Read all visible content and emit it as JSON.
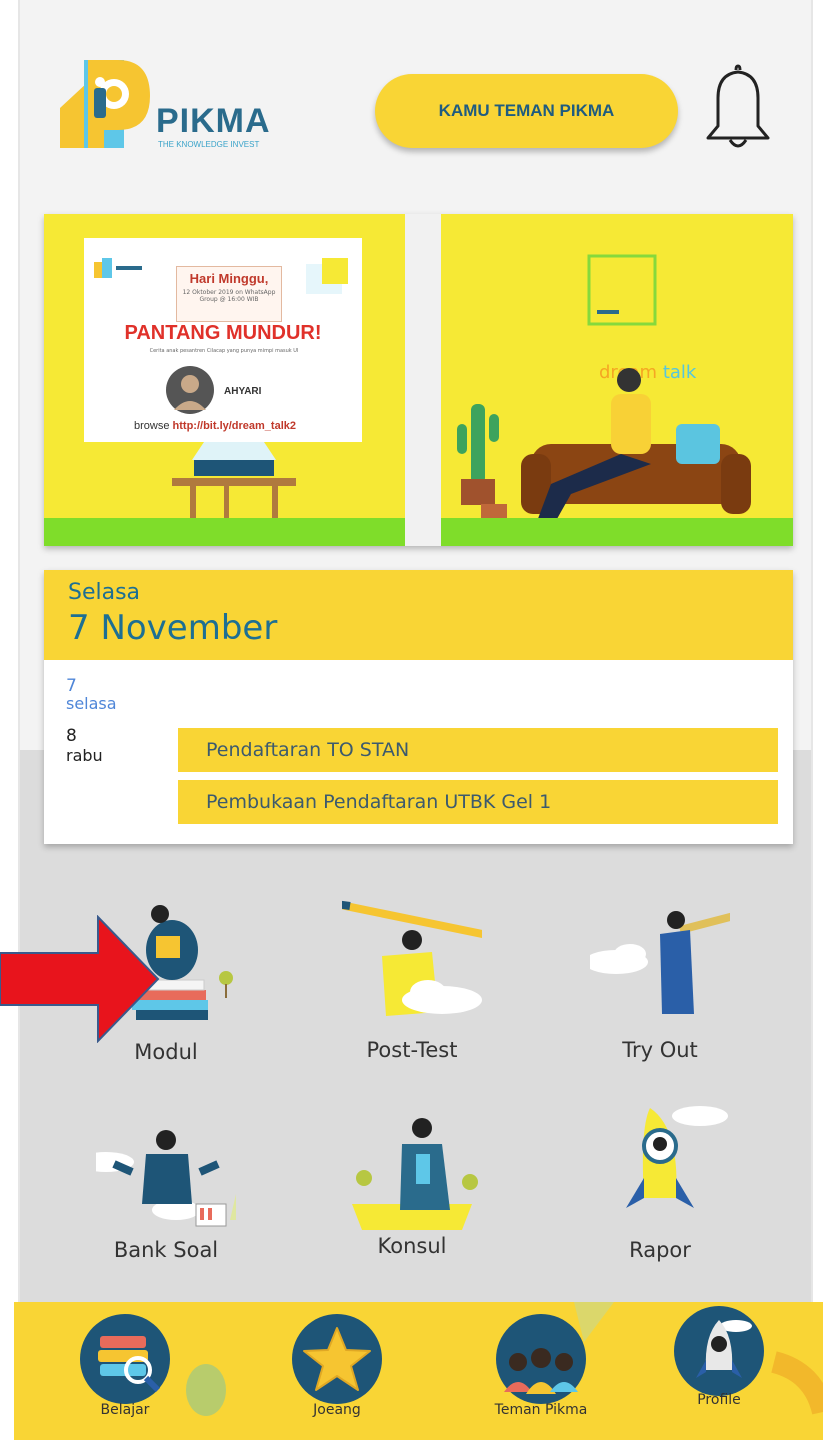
{
  "header": {
    "logo_text": "PIKMA",
    "logo_subtitle": "THE KNOWLEDGE INVEST",
    "teman_button": "KAMU TEMAN PIKMA"
  },
  "banner": {
    "poster_date": "Hari Minggu,",
    "poster_date_sub": "12 Oktober 2019 on WhatsApp Group @ 16:00 WIB",
    "poster_title": "PANTANG MUNDUR!",
    "poster_tagline": "Cerita anak pesantren Cilacap yang punya mimpi masuk UI",
    "speaker_name": "AHYARI",
    "link_prefix": "browse",
    "link_url": "http://bit.ly/dream_talk2",
    "brand_right_1": "dream",
    "brand_right_2": "talk"
  },
  "calendar": {
    "header_day": "Selasa",
    "header_date": "7 November",
    "days": [
      {
        "num": "7",
        "label": "selasa"
      },
      {
        "num": "8",
        "label": "rabu"
      }
    ],
    "events": [
      "Pendaftaran TO STAN",
      "Pembukaan Pendaftaran UTBK Gel 1"
    ]
  },
  "menu": [
    {
      "label": "Modul"
    },
    {
      "label": "Post-Test"
    },
    {
      "label": "Try Out"
    },
    {
      "label": "Bank Soal"
    },
    {
      "label": "Konsul"
    },
    {
      "label": "Rapor"
    }
  ],
  "bottom_nav": [
    {
      "label": "Belajar",
      "icon": "books-icon"
    },
    {
      "label": "Joeang",
      "icon": "star-icon"
    },
    {
      "label": "Teman Pikma",
      "icon": "friends-icon"
    },
    {
      "label": "Profile",
      "icon": "rocket-icon"
    }
  ],
  "colors": {
    "yellow": "#f9d535",
    "navy": "#1e5577",
    "teal_text": "#1d6f93",
    "annotation_arrow": "#e8141c"
  }
}
